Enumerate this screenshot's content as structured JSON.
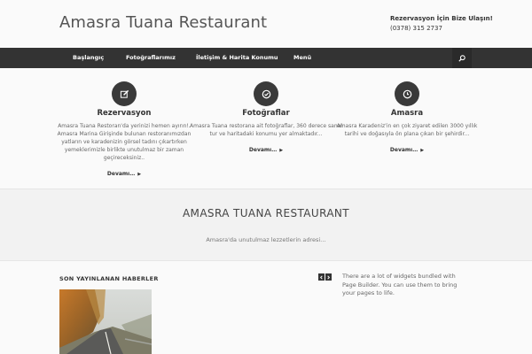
{
  "header": {
    "site_title": "Amasra Tuana Restaurant",
    "contact_title": "Rezervasyon İçin Bize Ulaşın!",
    "contact_phone": "(0378) 315 2737"
  },
  "nav": {
    "items": [
      "Başlangıç",
      "Fotoğraflarımız",
      "İletişim & Harita Konumu",
      "Menü"
    ],
    "search_icon": "search-icon"
  },
  "features": [
    {
      "icon": "edit-icon",
      "title": "Rezervasyon",
      "text": "Amasra Tuana Restoran'da yerinizi hemen ayırın!. Amasra Marina Girişinde bulunan restoranımızdan yatların ve karadenizin görsel tadını çıkartırken yemeklerimizle birlikte unutulmaz bir zaman geçireceksiniz..",
      "more": "Devamı…"
    },
    {
      "icon": "check-circle-icon",
      "title": "Fotoğraflar",
      "text": "Amasra Tuana restorana ait fotoğraflar, 360 derece sanal tur ve haritadaki konumu yer almaktadır...",
      "more": "Devamı…"
    },
    {
      "icon": "clock-icon",
      "title": "Amasra",
      "text": "Amasra Karadeniz'in en çok ziyaret edilen 3000 yıllık tarihi ve doğasıyla ön plana çıkan bir şehirdir...",
      "more": "Devamı…"
    }
  ],
  "hero": {
    "title": "AMASRA TUANA RESTAURANT",
    "subtitle": "Amasra'da unutulmaz lezzetlerin adresi…"
  },
  "news": {
    "heading": "SON YAYINLANAN HABERLER",
    "prev_icon": "chevron-left-icon",
    "next_icon": "chevron-right-icon"
  },
  "widget": {
    "text": "There are a lot of widgets bundled with Page Builder. You can use them to bring your pages to life."
  },
  "colors": {
    "nav_bg": "#333333",
    "icon_circle": "#3a3a3a",
    "hero_bg": "#f2f2f2"
  }
}
